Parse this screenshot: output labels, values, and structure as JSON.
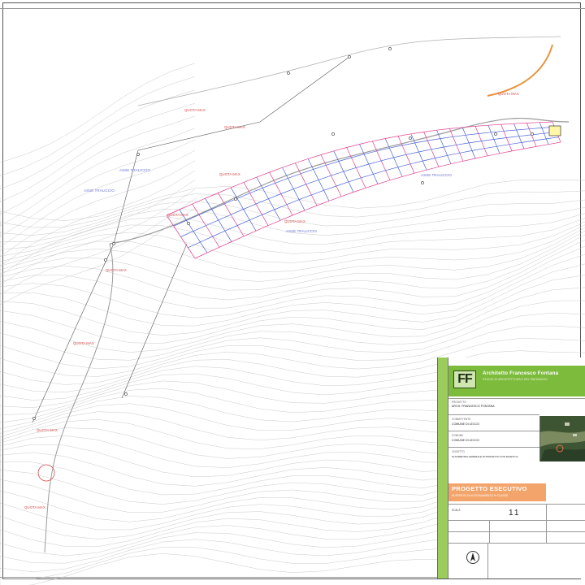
{
  "drawing": {
    "map_labels": [
      {
        "text": "ASSE TRALICCIO",
        "kind": "blue"
      },
      {
        "text": "ASSE TRALICCIO",
        "kind": "blue"
      },
      {
        "text": "ASSE TRALICCIO",
        "kind": "blue"
      },
      {
        "text": "ASSE TRALICCIO",
        "kind": "blue"
      },
      {
        "text": "QUOTA MAX",
        "kind": "red"
      },
      {
        "text": "QUOTA MAX",
        "kind": "red"
      },
      {
        "text": "QUOTA MAX",
        "kind": "red"
      },
      {
        "text": "QUOTA MAX",
        "kind": "red"
      },
      {
        "text": "QUOTA MAX",
        "kind": "red"
      },
      {
        "text": "QUOTA MAX",
        "kind": "red"
      },
      {
        "text": "QUOTA MAX",
        "kind": "red"
      },
      {
        "text": "QUOTA MAX",
        "kind": "red"
      },
      {
        "text": "QUOTA MAX",
        "kind": "red"
      },
      {
        "text": "QUOTA MAX",
        "kind": "red"
      }
    ]
  },
  "titleblock": {
    "logo": "FF",
    "firm_name": "Architetto Francesco Fontana",
    "firm_sub": "STUDIO DI ARCHITETTURA E DEL PAESAGGIO",
    "field_label_1": "PROGETTO",
    "field_value_1": "ARCH. FRANCESCO FONTANA",
    "field_label_2": "COMMITTENTE",
    "field_value_2": "COMUNE DI LECCO",
    "field_label_3": "COMUNE",
    "field_value_3": "COMUNE DI LECCO",
    "field_label_4": "OGGETTO",
    "field_value_4": "PLANIMETRIA GENERALE DI PROGETTO CON RILIEVO E",
    "project_phase": "PROGETTO ESECUTIVO",
    "project_sub": "SUPERFICI DI AVVICINAMENTO % CLASSE",
    "sheet_number": "11",
    "scale_label": "SCALA"
  },
  "colors": {
    "grid_pink": "#e0418f",
    "grid_blue": "#4a63d6",
    "green_band": "#7dbb3c",
    "orange": "#f3a46a",
    "contour": "#bcbcbc"
  }
}
